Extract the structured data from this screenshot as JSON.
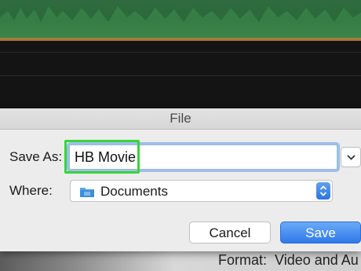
{
  "dialog": {
    "title": "File",
    "save_as_label": "Save As:",
    "name_value": "HB Movie",
    "where_label": "Where:",
    "location": "Documents",
    "cancel_label": "Cancel",
    "save_label": "Save"
  },
  "background": {
    "format_label": "Format:",
    "format_value": "Video and Au"
  },
  "colors": {
    "accent": "#2f79ea",
    "highlight": "#39d43b",
    "focus_ring": "#9cc0ea",
    "waveform": "#2f6b3f"
  },
  "icons": {
    "expand": "chevron-down-icon",
    "folder": "folder-icon",
    "stepper": "up-down-arrows-icon"
  }
}
